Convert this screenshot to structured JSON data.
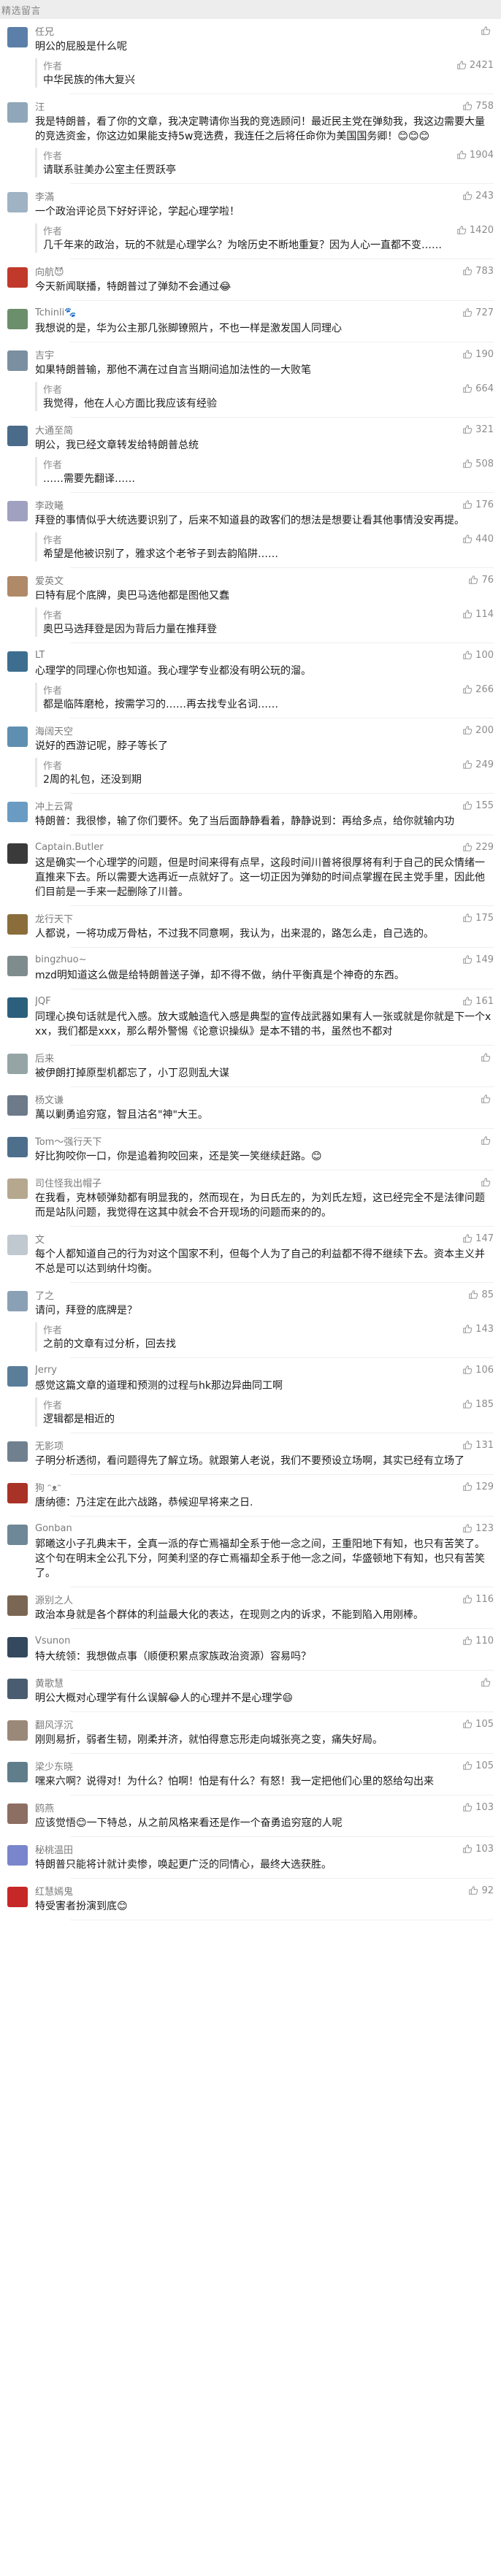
{
  "header": {
    "title": "精选留言"
  },
  "comments": [
    {
      "nick": "任兄",
      "avatar_color": "#5b7fa8",
      "likes": "",
      "text": "明公的屁股是什么呢",
      "reply": {
        "author": "作者",
        "likes": "2421",
        "text": "中华民族的伟大复兴"
      }
    },
    {
      "nick": "汪",
      "avatar_color": "#8fa7b8",
      "likes": "758",
      "text": "我是特朗普，看了你的文章，我决定聘请你当我的竞选顾问！最近民主党在弹劾我，我这边需要大量的竞选资金，你这边如果能支持5w竞选费，我连任之后将任命你为美国国务卿！😊😊😊",
      "reply": {
        "author": "作者",
        "likes": "1904",
        "text": "请联系驻美办公室主任贾跃亭"
      }
    },
    {
      "nick": "李滿",
      "avatar_color": "#9fb3c4",
      "likes": "243",
      "text": "一个政治评论员下好好评论，学起心理学啦！",
      "reply": {
        "author": "作者",
        "likes": "1420",
        "text": "几千年来的政治，玩的不就是心理学么？为啥历史不断地重复？因为人心一直都不变……"
      }
    },
    {
      "nick": "向航😈",
      "avatar_color": "#c0392b",
      "likes": "783",
      "text": "今天新闻联播，特朗普过了弹劾不会通过😂",
      "reply": null
    },
    {
      "nick": "Tchinli🐾",
      "avatar_color": "#6b8e6b",
      "likes": "727",
      "text": "我想说的是，华为公主那几张脚镣照片，不也一样是激发国人同理心",
      "reply": null
    },
    {
      "nick": "吉宇",
      "avatar_color": "#7a8fa0",
      "likes": "190",
      "text": "如果特朗普输，那他不满在过自言当期间追加法性的一大败笔",
      "reply": {
        "author": "作者",
        "likes": "664",
        "text": "我觉得，他在人心方面比我应该有经验"
      }
    },
    {
      "nick": "大通至简",
      "avatar_color": "#4a6b8a",
      "likes": "321",
      "text": "明公，我已经文章转发给特朗普总统",
      "reply": {
        "author": "作者",
        "likes": "508",
        "text": "……需要先翻译……"
      }
    },
    {
      "nick": "李政曦",
      "avatar_color": "#a0a0c0",
      "likes": "176",
      "text": "拜登的事情似乎大统选要识别了，后来不知道县的政客们的想法是想要让看其他事情没安再提。",
      "reply": {
        "author": "作者",
        "likes": "440",
        "text": "希望是他被识别了，雅求这个老爷子到去韵陷阱……"
      }
    },
    {
      "nick": "爱英文",
      "avatar_color": "#b08968",
      "likes": "76",
      "text": "曰特有屁个底牌，奥巴马选他都是图他又蠢",
      "reply": {
        "author": "作者",
        "likes": "114",
        "text": "奥巴马选拜登是因为背后力量在推拜登"
      }
    },
    {
      "nick": "LT",
      "avatar_color": "#3d6e8f",
      "likes": "100",
      "text": "心理学的同理心你也知道。我心理学专业都没有明公玩的溜。",
      "reply": {
        "author": "作者",
        "likes": "266",
        "text": "都是临阵磨枪，按需学习的……再去找专业名词……"
      }
    },
    {
      "nick": "海阔天空",
      "avatar_color": "#5f8fb0",
      "likes": "200",
      "text": "说好的西游记呢，脖子等长了",
      "reply": {
        "author": "作者",
        "likes": "249",
        "text": "2周的礼包，还没到期"
      }
    },
    {
      "nick": "冲上云霄",
      "avatar_color": "#6a9bc3",
      "likes": "155",
      "text": "特朗普：我很惨，输了你们要怀。免了当后面静静看着，静静说到：再给多点，给你就输内功",
      "reply": null
    },
    {
      "nick": "Captain.Butler",
      "avatar_color": "#3a3a3a",
      "likes": "229",
      "text": "这是确实一个心理学的问题，但是时间来得有点早，这段时间川普将很厚将有利于自己的民众情绪一直推来下去。所以需要大选再近一点就好了。这一切正因为弹劾的时间点掌握在民主党手里，因此他们目前是一手来一起删除了川普。",
      "reply": null
    },
    {
      "nick": "龙行天下",
      "avatar_color": "#8a6d3b",
      "likes": "175",
      "text": "人都说，一将功成万骨枯，不过我不同意啊，我认为，出来混的，路怎么走，自己选的。",
      "reply": null
    },
    {
      "nick": "bingzhuo~",
      "avatar_color": "#7f8c8d",
      "likes": "149",
      "text": "mzd明知道这么做是给特朗普送子弹，却不得不做，纳什平衡真是个神奇的东西。",
      "reply": null
    },
    {
      "nick": "JQF",
      "avatar_color": "#2c5f7c",
      "likes": "161",
      "text": "同理心换句话就是代入感。放大或触造代入感是典型的宣传战武器如果有人一张或就是你就是下一个xxx，我们都是xxx，那么帮外警惕《论意识操纵》是本不错的书，虽然也不都对",
      "reply": null
    },
    {
      "nick": "后来",
      "avatar_color": "#95a5a6",
      "likes": "",
      "text": "被伊朗打掉原型机都忘了，小丁忍则乱大谋",
      "reply": null
    },
    {
      "nick": "杨文谦",
      "avatar_color": "#6c7a89",
      "likes": "",
      "text": "萬以剿勇追穷寇，智且沽名\"神\"大王。",
      "reply": null
    },
    {
      "nick": "Tom～强行天下",
      "avatar_color": "#4d6f8c",
      "likes": "",
      "text": "好比狗咬你一口，你是追着狗咬回来，还是笑一笑继续赶路。😊",
      "reply": null
    },
    {
      "nick": "司住怪我出帽子",
      "avatar_color": "#b5a88f",
      "likes": "",
      "text": "在我看，克林顿弹劾都有明显我的，然而现在，为日氏左的，为刘氏左短，这已经完全不是法律问题而是站队问题，我觉得在这其中就会不合开现场的问题而来的的。",
      "reply": null
    },
    {
      "nick": "文",
      "avatar_color": "#c0c8d0",
      "likes": "147",
      "text": "每个人都知道自己的行为对这个国家不利，但每个人为了自己的利益都不得不继续下去。资本主义并不总是可以达到纳什均衡。",
      "reply": null
    },
    {
      "nick": "了之",
      "avatar_color": "#8aa0b5",
      "likes": "85",
      "text": "请问，拜登的底牌是？",
      "reply": {
        "author": "作者",
        "likes": "143",
        "text": "之前的文章有过分析，回去找"
      }
    },
    {
      "nick": "Jerry",
      "avatar_color": "#5a7d9a",
      "likes": "106",
      "text": "感觉这篇文章的道理和预测的过程与hk那边异曲同工啊",
      "reply": {
        "author": "作者",
        "likes": "185",
        "text": "逻辑都是相近的"
      }
    },
    {
      "nick": "无影项",
      "avatar_color": "#70808f",
      "likes": "131",
      "text": "子明分析透彻，看问题得先了解立场。就跟第人老说，我们不要预设立场啊，其实已经有立场了",
      "reply": null
    },
    {
      "nick": "狗 ᵔᴥᵔ",
      "avatar_color": "#a93226",
      "likes": "129",
      "text": "唐纳德：乃注定在此六战路，恭候迎早将来之日.",
      "reply": null
    },
    {
      "nick": "Gonban",
      "avatar_color": "#6e8898",
      "likes": "123",
      "text": "郭曦这小子孔典末干，全真一派的存亡焉福却全系于他一念之间，王重阳地下有知，也只有苦笑了。这个句在明末全公孔下分，阿美利坚的存亡焉福却全系于他一念之间，华盛顿地下有知，也只有苦笑了。",
      "reply": null
    },
    {
      "nick": "源别之人",
      "avatar_color": "#7a6652",
      "likes": "116",
      "text": "政治本身就是各个群体的利益最大化的表达，在现则之内的诉求，不能到陷入用刚棒。",
      "reply": null
    },
    {
      "nick": "Vsunon",
      "avatar_color": "#34495e",
      "likes": "110",
      "text": "特大统领：我想做点事（顺便积累点家族政治资源）容易吗？",
      "reply": null
    },
    {
      "nick": "黄歌慧",
      "avatar_color": "#4a5d70",
      "likes": "",
      "text": "明公大概对心理学有什么误解😂人的心理并不是心理学😄",
      "reply": null
    },
    {
      "nick": "翻风浮沉",
      "avatar_color": "#9a8878",
      "likes": "105",
      "text": "刚则易折，弱者生韧，刚柔并济，就怕得意忘形走向城张亮之变，痛失好局。",
      "reply": null
    },
    {
      "nick": "梁少东晓",
      "avatar_color": "#607d8b",
      "likes": "105",
      "text": "嘿来六啊？说得对！为什么？怕啊！怕是有什么？有怒！我一定把他们心里的怒给勾出来",
      "reply": null
    },
    {
      "nick": "鸥燕",
      "avatar_color": "#8d6e63",
      "likes": "103",
      "text": "应该觉悟😊一下特总，从之前风格来看还是作一个奋勇追穷寇的人呢",
      "reply": null
    },
    {
      "nick": "秘桃温田",
      "avatar_color": "#7986cb",
      "likes": "103",
      "text": "特朗普只能将计就计卖惨，唤起更广泛的同情心，最终大选获胜。",
      "reply": null
    },
    {
      "nick": "红慧嫣鬼",
      "avatar_color": "#c62828",
      "likes": "92",
      "text": "特受害者扮演到底😊",
      "reply": null
    }
  ]
}
